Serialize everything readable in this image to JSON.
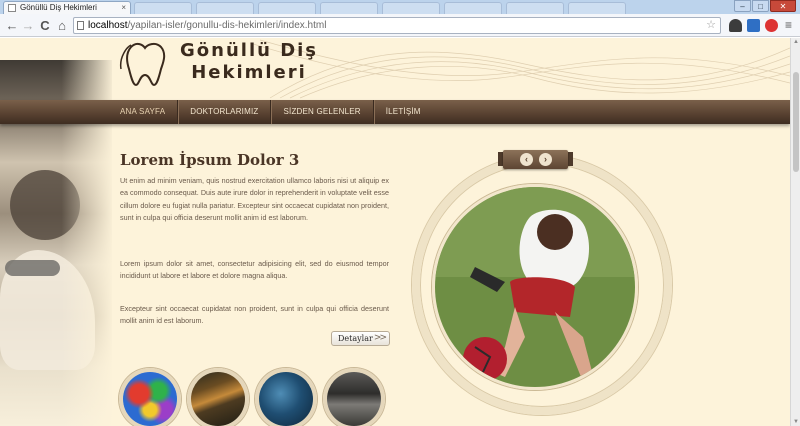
{
  "browser": {
    "tab_title": "Gönüllü Diş Hekimleri",
    "tab_close": "×",
    "url_host": "localhost",
    "url_path": "/yapilan-isler/gonullu-dis-hekimleri/index.html",
    "back_symbol": "←",
    "forward_symbol": "→",
    "reload_symbol": "C",
    "home_symbol": "⌂",
    "star_symbol": "☆",
    "window_min": "–",
    "window_max": "□",
    "window_close": "✕"
  },
  "site": {
    "logo_line1": "Gönüllü Diş",
    "logo_line2": "Hekimleri",
    "nav": [
      "ANA SAYFA",
      "DOKTORLARIMIZ",
      "SİZDEN GELENLER",
      "İLETİŞİM"
    ],
    "article": {
      "title": "Lorem İpsum Dolor 3",
      "paragraphs": [
        "Ut enim ad minim veniam, quis nostrud exercitation ullamco laboris nisi ut aliquip ex ea commodo consequat. Duis aute irure dolor in reprehenderit in voluptate velit esse cillum dolore eu fugiat nulla pariatur. Excepteur sint occaecat cupidatat non proident, sunt in culpa qui officia deserunt mollit anim id est laborum.",
        "Lorem ipsum dolor sit amet, consectetur adipisicing elit, sed do eiusmod tempor incididunt ut labore et labore et dolore magna aliqua.",
        "Excepteur sint occaecat cupidatat non proident, sunt in culpa qui officia deserunt mollit anim id est laborum."
      ],
      "detail_button": "Detaylar",
      "detail_chevron": ">>"
    },
    "slider": {
      "prev_symbol": "‹",
      "next_symbol": "›"
    },
    "colors": {
      "background": "#fdf3da",
      "nav_bar": "#5a4332",
      "title": "#4a3526",
      "body_text": "#6a5a4b"
    }
  }
}
